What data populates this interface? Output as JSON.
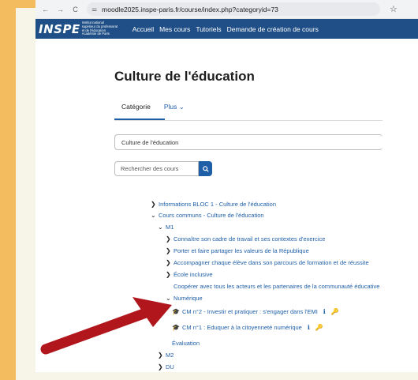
{
  "browser": {
    "url": "moodle2025.inspe-paris.fr/course/index.php?categoryid=73",
    "back_icon": "←",
    "forward_icon": "→",
    "reload_icon": "C",
    "star_icon": "☆"
  },
  "header": {
    "logo_mark": "INSPE",
    "logo_lines": [
      "Institut national",
      "supérieur du professorat",
      "et de l'éducation",
      "Académie de Paris"
    ],
    "menu": [
      "Accueil",
      "Mes cours",
      "Tutoriels",
      "Demande de création de cours"
    ]
  },
  "page": {
    "title": "Culture de l'éducation",
    "tabs": [
      "Catégorie",
      "Plus ⌄"
    ],
    "category_select": "Culture de l'éducation",
    "search_placeholder": "Rechercher des cours"
  },
  "tree": [
    {
      "caret": "❯",
      "label": "Informations BLOC 1 - Culture de l'éducation"
    },
    {
      "caret": "⌄",
      "label": "Cours communs - Culture de l'éducation"
    },
    {
      "caret": "⌄",
      "label": "M1"
    },
    {
      "caret": "❯",
      "label": "Connaître son cadre de travail et ses contextes d'exercice"
    },
    {
      "caret": "❯",
      "label": "Porter et faire partager les valeurs de la République"
    },
    {
      "caret": "❯",
      "label": "Accompagner chaque élève dans son parcours de formation et de réussite"
    },
    {
      "caret": "❯",
      "label": "École inclusive"
    },
    {
      "caret": "",
      "label": "Coopérer avec tous les acteurs et les partenaires de la communauté éducative"
    },
    {
      "caret": "⌄",
      "label": "Numérique"
    },
    {
      "caret": "",
      "label": "CM n°2 - Investir et pratiquer : s'engager dans l'EMI"
    },
    {
      "caret": "",
      "label": "CM n°1 : Eduquer à la citoyenneté numérique"
    },
    {
      "caret": "",
      "label": "Évaluation"
    },
    {
      "caret": "❯",
      "label": "M2"
    },
    {
      "caret": "❯",
      "label": "DU"
    }
  ],
  "colors": {
    "background": "#f3bd5f",
    "navbar": "#1f4f86",
    "link": "#1f5fa8",
    "arrow": "#b0161c"
  }
}
